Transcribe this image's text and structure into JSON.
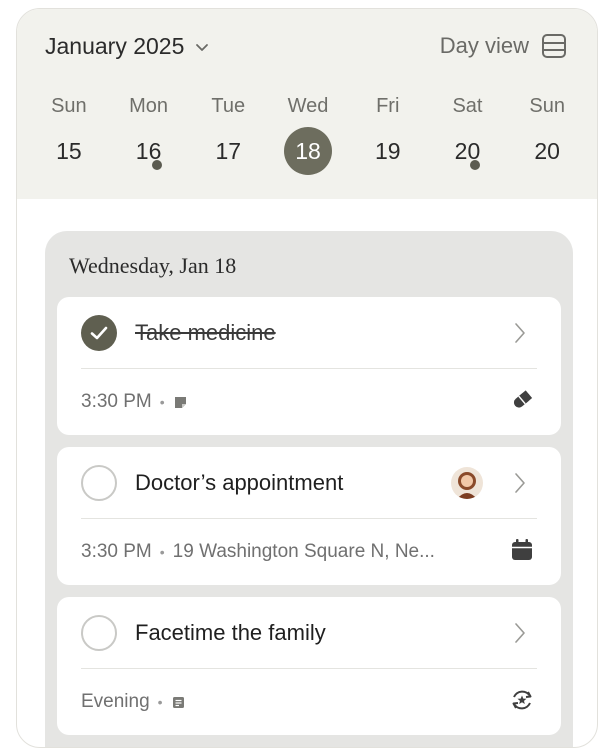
{
  "header": {
    "month_label": "January 2025",
    "view_label": "Day view"
  },
  "week": [
    {
      "name": "Sun",
      "num": "15",
      "selected": false,
      "dot": false
    },
    {
      "name": "Mon",
      "num": "16",
      "selected": false,
      "dot": true
    },
    {
      "name": "Tue",
      "num": "17",
      "selected": false,
      "dot": false
    },
    {
      "name": "Wed",
      "num": "18",
      "selected": true,
      "dot": false
    },
    {
      "name": "Fri",
      "num": "19",
      "selected": false,
      "dot": false
    },
    {
      "name": "Sat",
      "num": "20",
      "selected": false,
      "dot": true
    },
    {
      "name": "Sun",
      "num": "20",
      "selected": false,
      "dot": false
    }
  ],
  "agenda": {
    "date_heading": "Wednesday, Jan 18",
    "tasks": [
      {
        "title": "Take medicine",
        "completed": true,
        "meta": "3:30 PM",
        "meta_icon": "note-icon",
        "right_icon": "pill-icon"
      },
      {
        "title": "Doctor’s appointment",
        "completed": false,
        "meta": "3:30 PM",
        "location": "19 Washington Square N, Ne...",
        "right_icon": "calendar-icon",
        "avatar": "person-avatar"
      },
      {
        "title": "Facetime the family",
        "completed": false,
        "meta": "Evening",
        "meta_icon": "note-icon",
        "right_icon": "repeat-star-icon"
      }
    ]
  },
  "colors": {
    "header_bg": "#f2f2ed",
    "accent": "#6d6d5e",
    "panel_bg": "#e5e5e3"
  }
}
